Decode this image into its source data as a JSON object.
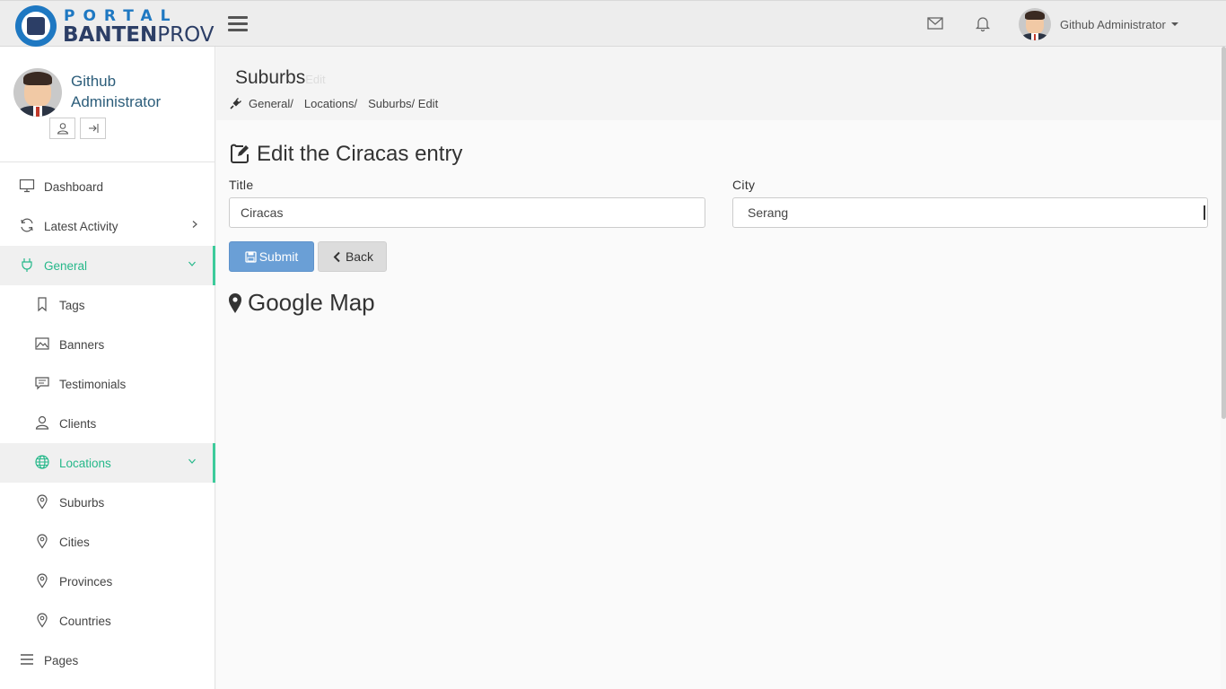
{
  "brand": {
    "line1": "PORTAL",
    "line2_bold": "BANTEN",
    "line2_light": "PROV"
  },
  "topbar": {
    "user_name": "Github Administrator"
  },
  "sidebar": {
    "profile_name": "Github Administrator",
    "items": [
      {
        "label": "Dashboard",
        "icon": "monitor-icon"
      },
      {
        "label": "Latest Activity",
        "icon": "refresh-icon"
      },
      {
        "label": "General",
        "icon": "plug-icon"
      },
      {
        "label": "Tags",
        "icon": "bookmark-icon"
      },
      {
        "label": "Banners",
        "icon": "image-icon"
      },
      {
        "label": "Testimonials",
        "icon": "comment-icon"
      },
      {
        "label": "Clients",
        "icon": "user-icon"
      },
      {
        "label": "Locations",
        "icon": "globe-icon"
      },
      {
        "label": "Suburbs",
        "icon": "map-pin-icon"
      },
      {
        "label": "Cities",
        "icon": "map-pin-icon"
      },
      {
        "label": "Provinces",
        "icon": "map-pin-icon"
      },
      {
        "label": "Countries",
        "icon": "map-pin-icon"
      },
      {
        "label": "Pages",
        "icon": "list-icon"
      }
    ]
  },
  "page": {
    "title": "Suburbs",
    "subtitle": "Edit",
    "breadcrumb": [
      "General/",
      "Locations/",
      "Suburbs/ Edit"
    ]
  },
  "form": {
    "heading": "Edit the Ciracas entry",
    "title_label": "Title",
    "title_value": "Ciracas",
    "city_label": "City",
    "city_value": "Serang",
    "submit_label": "Submit",
    "back_label": "Back",
    "map_heading": "Google Map"
  },
  "colors": {
    "accent": "#3dcb9b",
    "primary_button": "#6a9fd6",
    "brand_blue": "#1e78c2"
  }
}
